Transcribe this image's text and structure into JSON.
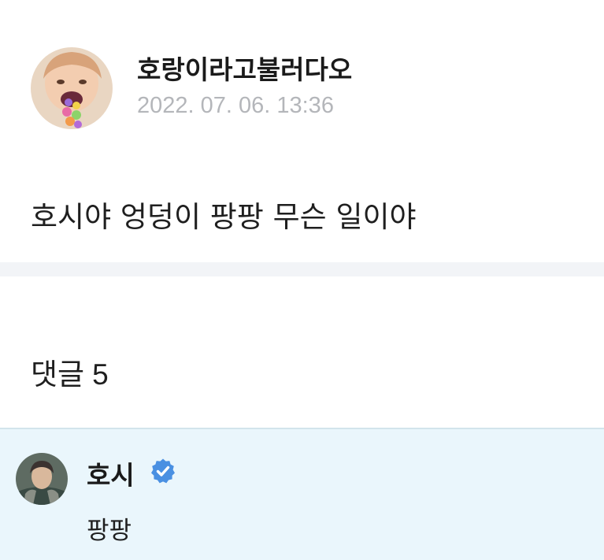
{
  "post": {
    "author": "호랑이라고불러다오",
    "timestamp": "2022. 07. 06. 13:36",
    "body": "호시야 엉덩이 팡팡 무슨 일이야",
    "author_avatar_icon": "profile-photo"
  },
  "comments_section": {
    "label": "댓글",
    "count": "5"
  },
  "comments": [
    {
      "author": "호시",
      "verified": true,
      "verified_icon": "verified-check-badge",
      "text": "팡팡",
      "avatar_icon": "profile-photo"
    }
  ],
  "colors": {
    "timestamp": "#b4b6ba",
    "divider": "#f2f4f7",
    "comment_highlight": "#eaf6fc",
    "verified_badge": "#4a90e2"
  }
}
